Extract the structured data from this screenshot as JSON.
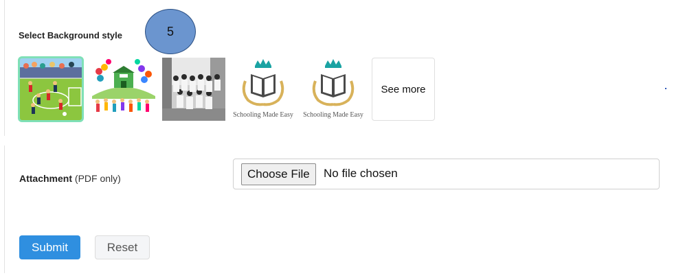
{
  "background_section": {
    "label": "Select Background style",
    "step_badge": "5",
    "thumbnails": [
      {
        "name": "sports-field",
        "selected": true
      },
      {
        "name": "school-balloons",
        "selected": false
      },
      {
        "name": "class-photo",
        "selected": false
      },
      {
        "name": "logo",
        "caption": "Schooling Made Easy",
        "selected": false
      },
      {
        "name": "logo",
        "caption": "Schooling Made Easy",
        "selected": false
      }
    ],
    "see_more_label": "See more"
  },
  "attachment": {
    "label": "Attachment",
    "hint": "(PDF only)",
    "choose_file_label": "Choose File",
    "no_file_text": "No file chosen"
  },
  "actions": {
    "submit_label": "Submit",
    "reset_label": "Reset"
  },
  "colors": {
    "primary": "#2f8fe0",
    "selected_outline": "#7fe0b7",
    "badge_fill": "#6b95cf",
    "logo_teal": "#1aa3a3",
    "logo_gold": "#d8b25a"
  }
}
